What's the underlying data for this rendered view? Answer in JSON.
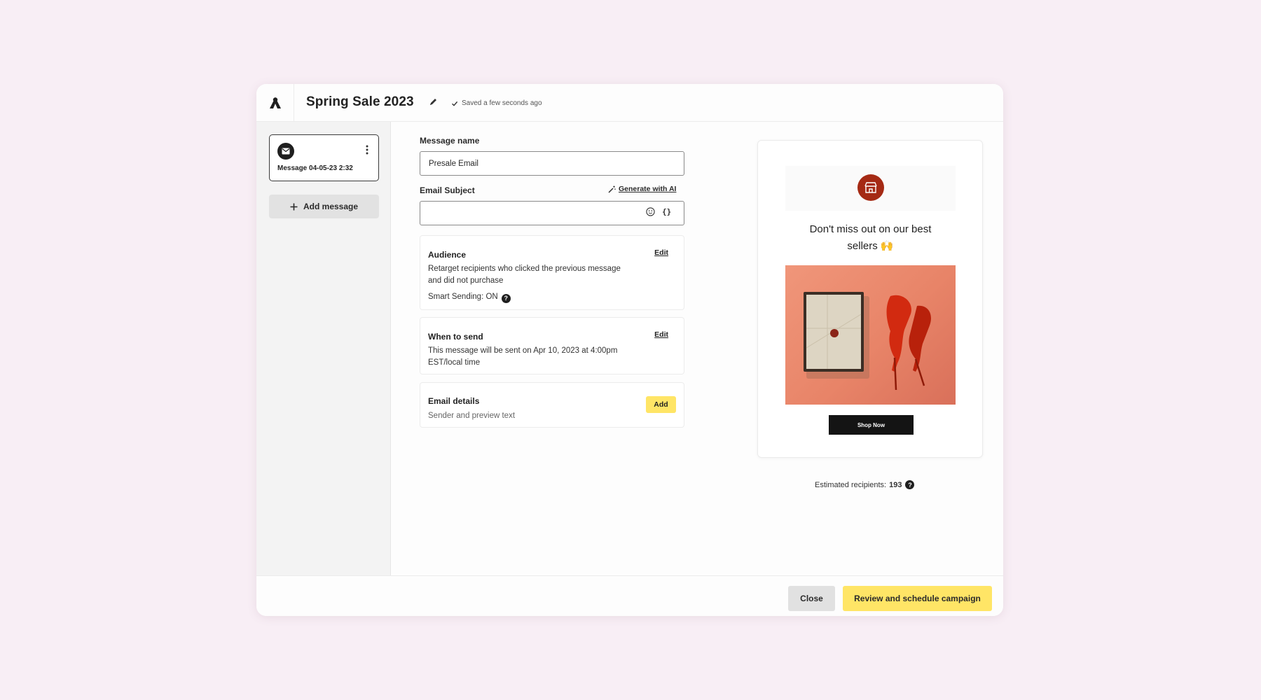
{
  "header": {
    "title": "Spring Sale 2023",
    "saved_status": "Saved a few seconds ago"
  },
  "sidebar": {
    "message_label": "Message 04-05-23 2:32",
    "add_message_label": "Add message"
  },
  "form": {
    "message_name_label": "Message name",
    "message_name_value": "Presale Email",
    "email_subject_label": "Email Subject",
    "generate_ai_label": "Generate with AI",
    "email_subject_value": "",
    "subject_braces": "{}"
  },
  "audience": {
    "title": "Audience",
    "edit_label": "Edit",
    "description_line1": "Retarget recipients who clicked the previous message",
    "description_line2": "and did not purchase",
    "smart_sending": "Smart Sending: ON"
  },
  "when_to_send": {
    "title": "When to send",
    "edit_label": "Edit",
    "description_line1": "This message will be sent on Apr 10, 2023 at 4:00pm",
    "description_line2": "EST/local time"
  },
  "email_details": {
    "title": "Email details",
    "subtitle": "Sender and preview text",
    "add_label": "Add"
  },
  "preview": {
    "headline_line1": "Don't miss out on our best",
    "headline_line2": "sellers 🙌",
    "shop_button": "Shop Now",
    "estimated_label": "Estimated recipients:",
    "estimated_value": "193"
  },
  "footer": {
    "close_label": "Close",
    "review_label": "Review and schedule campaign"
  },
  "colors": {
    "page_background": "#f8eef5",
    "accent_yellow": "#ffe566",
    "store_logo": "#a52a14"
  },
  "icons": [
    "brand-logo-icon",
    "pencil-icon",
    "check-icon",
    "email-icon",
    "kebab-icon",
    "plus-icon",
    "magic-wand-icon",
    "emoji-icon",
    "help-icon",
    "store-icon",
    "cursor-icon"
  ]
}
